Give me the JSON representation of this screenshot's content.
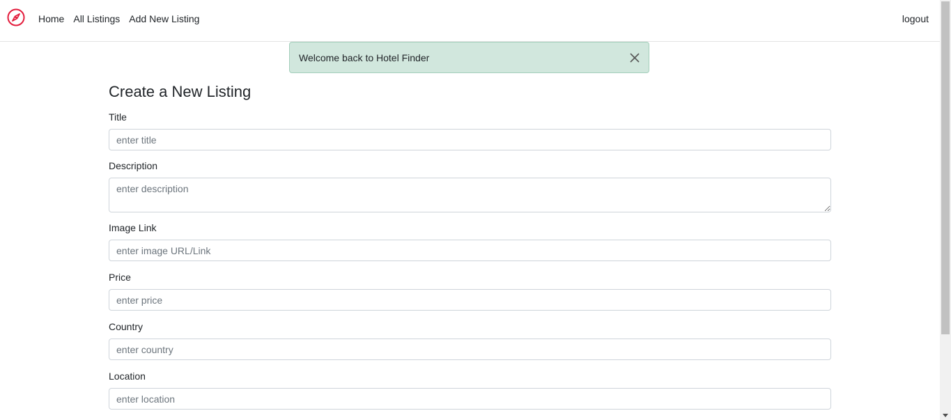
{
  "nav": {
    "brand_icon": "compass-icon",
    "brand_color": "#e31b3b",
    "links": [
      "Home",
      "All Listings",
      "Add New Listing"
    ],
    "logout": "logout"
  },
  "alert": {
    "message": "Welcome back to Hotel Finder",
    "close_icon": "close-icon",
    "background": "#d1e7dd"
  },
  "form": {
    "heading": "Create a New Listing",
    "fields": {
      "title": {
        "label": "Title",
        "placeholder": "enter title"
      },
      "description": {
        "label": "Description",
        "placeholder": "enter description"
      },
      "image": {
        "label": "Image Link",
        "placeholder": "enter image URL/Link"
      },
      "price": {
        "label": "Price",
        "placeholder": "enter price"
      },
      "country": {
        "label": "Country",
        "placeholder": "enter country"
      },
      "location": {
        "label": "Location",
        "placeholder": "enter location"
      }
    }
  }
}
